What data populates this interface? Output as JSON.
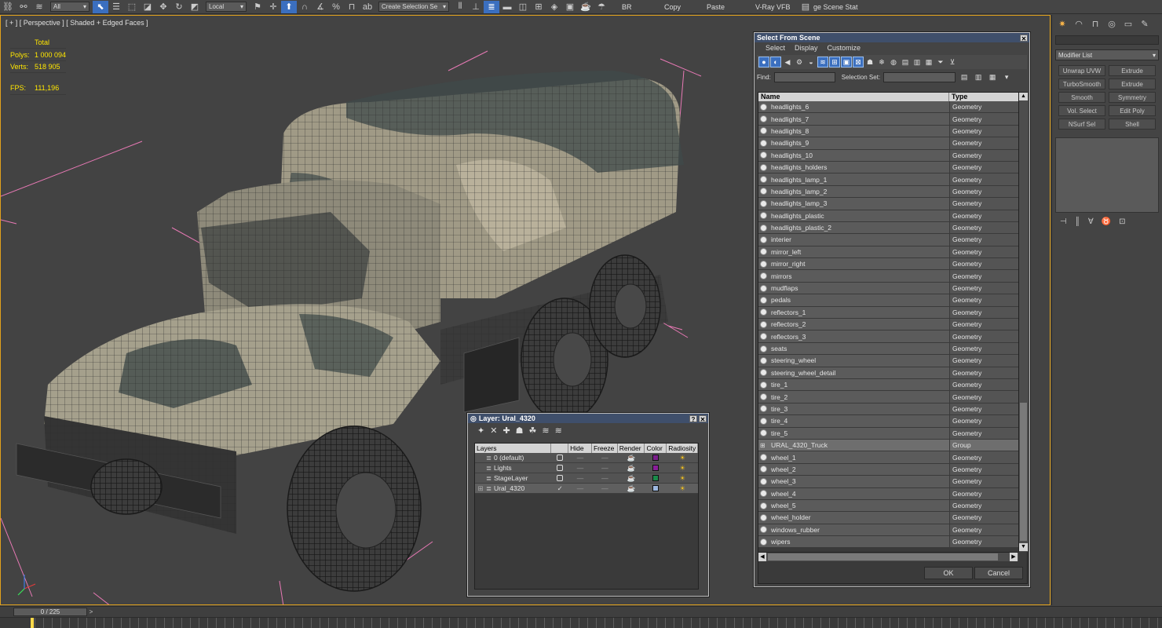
{
  "toolbar": {
    "selection_filter": "All",
    "ref_coord": "Local",
    "named_selection": "Create Selection Se",
    "br_label": "BR",
    "copy_label": "Copy",
    "paste_label": "Paste",
    "vray_label": "V-Ray VFB",
    "scene_states_label": "ge Scene Stat"
  },
  "viewport": {
    "label": "[ + ] [ Perspective ] [ Shaded + Edged Faces ]",
    "stats": {
      "total_label": "Total",
      "polys_label": "Polys:",
      "polys_value": "1 000 094",
      "verts_label": "Verts:",
      "verts_value": "518 905",
      "fps_label": "FPS:",
      "fps_value": "111,196"
    },
    "colors": {
      "border": "#e2a21c",
      "bbox": "#e879b5",
      "stats": "#ffe600"
    }
  },
  "command_panel": {
    "modifier_list": "Modifier List",
    "buttons": [
      "Unwrap UVW",
      "Extrude",
      "TurboSmooth",
      "Extrude",
      "Smooth",
      "Symmetry",
      "Vol. Select",
      "Edit Poly",
      "NSurf Sel",
      "Shell"
    ]
  },
  "select_from_scene": {
    "title": "Select From Scene",
    "menu": [
      "Select",
      "Display",
      "Customize"
    ],
    "find_label": "Find:",
    "selection_set_label": "Selection Set:",
    "col_name": "Name",
    "col_type": "Type",
    "items": [
      {
        "name": "headlights_6",
        "type": "Geometry"
      },
      {
        "name": "headlights_7",
        "type": "Geometry"
      },
      {
        "name": "headlights_8",
        "type": "Geometry"
      },
      {
        "name": "headlights_9",
        "type": "Geometry"
      },
      {
        "name": "headlights_10",
        "type": "Geometry"
      },
      {
        "name": "headlights_holders",
        "type": "Geometry"
      },
      {
        "name": "headlights_lamp_1",
        "type": "Geometry"
      },
      {
        "name": "headlights_lamp_2",
        "type": "Geometry"
      },
      {
        "name": "headlights_lamp_3",
        "type": "Geometry"
      },
      {
        "name": "headlights_plastic",
        "type": "Geometry"
      },
      {
        "name": "headlights_plastic_2",
        "type": "Geometry"
      },
      {
        "name": "interier",
        "type": "Geometry"
      },
      {
        "name": "mirror_left",
        "type": "Geometry"
      },
      {
        "name": "mirror_right",
        "type": "Geometry"
      },
      {
        "name": "mirrors",
        "type": "Geometry"
      },
      {
        "name": "mudflaps",
        "type": "Geometry"
      },
      {
        "name": "pedals",
        "type": "Geometry"
      },
      {
        "name": "reflectors_1",
        "type": "Geometry"
      },
      {
        "name": "reflectors_2",
        "type": "Geometry"
      },
      {
        "name": "reflectors_3",
        "type": "Geometry"
      },
      {
        "name": "seats",
        "type": "Geometry"
      },
      {
        "name": "steering_wheel",
        "type": "Geometry"
      },
      {
        "name": "steering_wheel_detail",
        "type": "Geometry"
      },
      {
        "name": "tire_1",
        "type": "Geometry"
      },
      {
        "name": "tire_2",
        "type": "Geometry"
      },
      {
        "name": "tire_3",
        "type": "Geometry"
      },
      {
        "name": "tire_4",
        "type": "Geometry"
      },
      {
        "name": "tire_5",
        "type": "Geometry"
      },
      {
        "name": "URAL_4320_Truck",
        "type": "Group"
      },
      {
        "name": "wheel_1",
        "type": "Geometry"
      },
      {
        "name": "wheel_2",
        "type": "Geometry"
      },
      {
        "name": "wheel_3",
        "type": "Geometry"
      },
      {
        "name": "wheel_4",
        "type": "Geometry"
      },
      {
        "name": "wheel_5",
        "type": "Geometry"
      },
      {
        "name": "wheel_holder",
        "type": "Geometry"
      },
      {
        "name": "windows_rubber",
        "type": "Geometry"
      },
      {
        "name": "wipers",
        "type": "Geometry"
      }
    ],
    "ok_label": "OK",
    "cancel_label": "Cancel"
  },
  "layer_window": {
    "title": "Layer: Ural_4320",
    "help_label": "?",
    "headers": [
      "Layers",
      "",
      "Hide",
      "Freeze",
      "Render",
      "Color",
      "Radiosity"
    ],
    "layers": [
      {
        "name": "0 (default)",
        "color": "#7a1f8a",
        "current": false
      },
      {
        "name": "Lights",
        "color": "#8a1f9a",
        "current": false
      },
      {
        "name": "StageLayer",
        "color": "#1b8a4a",
        "current": false
      },
      {
        "name": "Ural_4320",
        "color": "#9db8e0",
        "current": true
      }
    ]
  },
  "timeline": {
    "frame_label": "0 / 225"
  }
}
